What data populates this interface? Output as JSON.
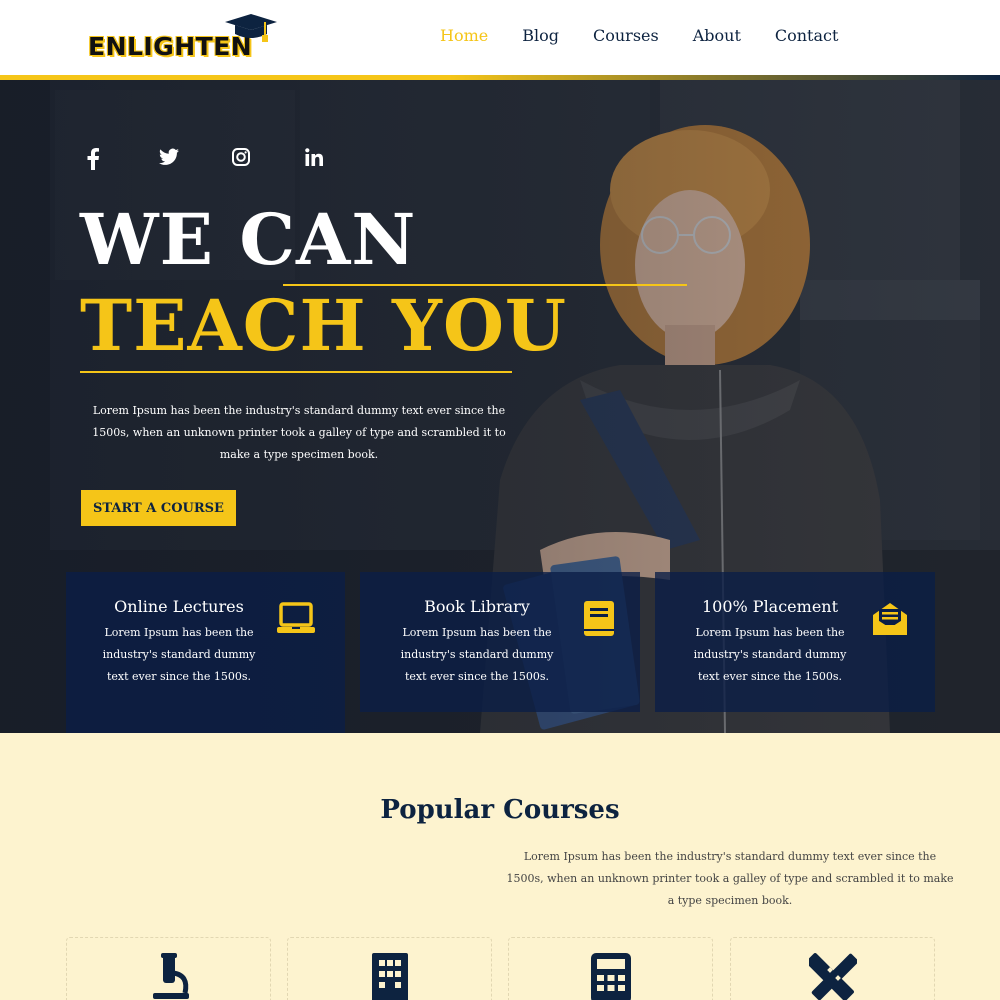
{
  "header": {
    "logo_text": "ENLIGHTEN",
    "nav": [
      "Home",
      "Blog",
      "Courses",
      "About",
      "Contact"
    ],
    "active_nav": "Home"
  },
  "hero": {
    "social_icons": [
      "facebook-icon",
      "twitter-icon",
      "instagram-icon",
      "linkedin-icon"
    ],
    "title_line1": "WE CAN",
    "title_line2": "TEACH YOU",
    "description": "Lorem Ipsum has been the industry's standard dummy text ever since the 1500s, when an unknown printer took a galley of type and scrambled it to make a type specimen book.",
    "button_label": "START A COURSE",
    "features": [
      {
        "title": "Online Lectures",
        "text": "Lorem Ipsum has been the industry's standard dummy text ever since the 1500s.",
        "icon": "laptop-icon"
      },
      {
        "title": "Book Library",
        "text": "Lorem Ipsum has been the industry's standard dummy text ever since the 1500s.",
        "icon": "book-icon"
      },
      {
        "title": "100% Placement",
        "text": "Lorem Ipsum has been the industry's standard dummy text ever since the 1500s.",
        "icon": "envelope-open-icon"
      }
    ]
  },
  "popular": {
    "title": "Popular Courses",
    "description": "Lorem Ipsum has been the industry's standard dummy text ever since the 1500s, when an unknown printer took a galley of type and scrambled it to make a type specimen book.",
    "course_icons": [
      "microscope-icon",
      "building-icon",
      "calculator-icon",
      "drafting-tools-icon"
    ]
  },
  "colors": {
    "accent": "#f5c518",
    "navy": "#0d2340",
    "section_bg": "#fdf3cf"
  }
}
